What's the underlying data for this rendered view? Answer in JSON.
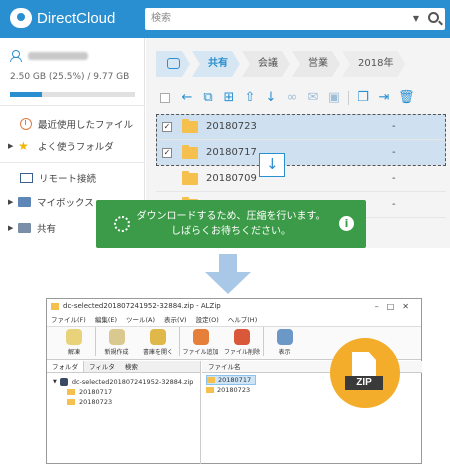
{
  "app": {
    "logo_text": "DirectCloud",
    "search_placeholder": "検索"
  },
  "sidebar": {
    "quota": "2.50 GB (25.5%) / 9.77 GB",
    "quota_fraction": 0.255,
    "items": [
      {
        "label": "最近使用したファイル",
        "icon": "clock-icon"
      },
      {
        "label": "よく使うフォルダ",
        "icon": "star-icon"
      },
      {
        "label": "リモート接続",
        "icon": "monitor-icon"
      },
      {
        "label": "マイボックス",
        "icon": "box-icon"
      },
      {
        "label": "共有",
        "icon": "share-icon"
      }
    ]
  },
  "breadcrumb": [
    "共有",
    "会議",
    "営業",
    "2018年"
  ],
  "files": [
    {
      "name": "20180723",
      "date": "-",
      "checked": true
    },
    {
      "name": "20180717",
      "date": "-",
      "checked": true
    },
    {
      "name": "20180709",
      "date": "-",
      "checked": false
    },
    {
      "name": "",
      "date": "-",
      "checked": false
    }
  ],
  "toast": {
    "line1": "ダウンロードするため、圧縮を行います。",
    "line2": "しばらくお待ちください。"
  },
  "alzip": {
    "title": "dc-selected201807241952-32884.zip - ALZip",
    "menu": [
      "ファイル(F)",
      "編集(E)",
      "ツール(A)",
      "表示(V)",
      "設定(O)",
      "ヘルプ(H)"
    ],
    "tools": [
      "解凍",
      "新規作成",
      "書庫を開く",
      "ファイル追加",
      "ファイル削除",
      "表示"
    ],
    "tabs": [
      "フォルダ",
      "フィルタ",
      "検索"
    ],
    "tree_root": "dc-selected201807241952-32884.zip",
    "tree_children": [
      "20180717",
      "20180723"
    ],
    "col_header": "ファイル名",
    "files": [
      "20180717",
      "20180723"
    ]
  },
  "zip_badge": "ZIP"
}
